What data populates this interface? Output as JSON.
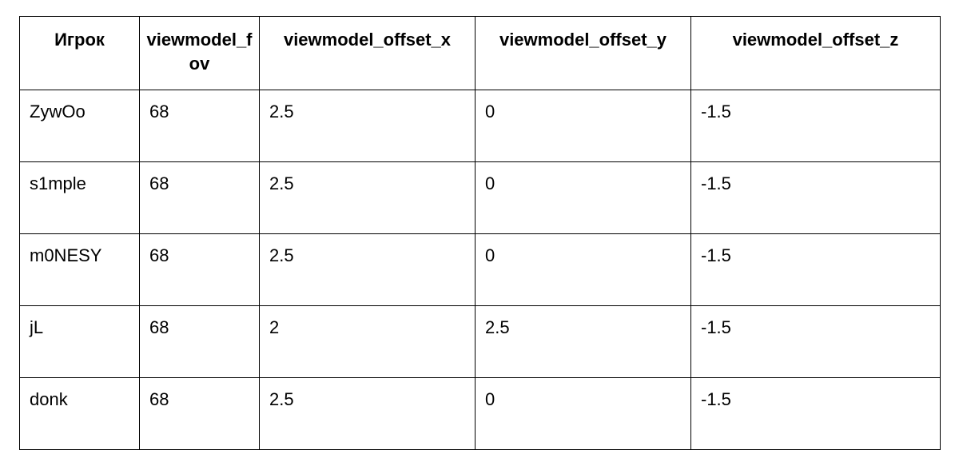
{
  "table": {
    "headers": {
      "player": "Игрок",
      "fov": "viewmodel_fov",
      "offset_x": "viewmodel_offset_x",
      "offset_y": "viewmodel_offset_y",
      "offset_z": "viewmodel_offset_z"
    },
    "rows": [
      {
        "player": "ZywOo",
        "fov": "68",
        "x": "2.5",
        "y": "0",
        "z": "-1.5"
      },
      {
        "player": "s1mple",
        "fov": "68",
        "x": "2.5",
        "y": "0",
        "z": "-1.5"
      },
      {
        "player": "m0NESY",
        "fov": "68",
        "x": "2.5",
        "y": "0",
        "z": "-1.5"
      },
      {
        "player": "jL",
        "fov": "68",
        "x": "2",
        "y": "2.5",
        "z": "-1.5"
      },
      {
        "player": "donk",
        "fov": "68",
        "x": "2.5",
        "y": "0",
        "z": "-1.5"
      }
    ]
  }
}
